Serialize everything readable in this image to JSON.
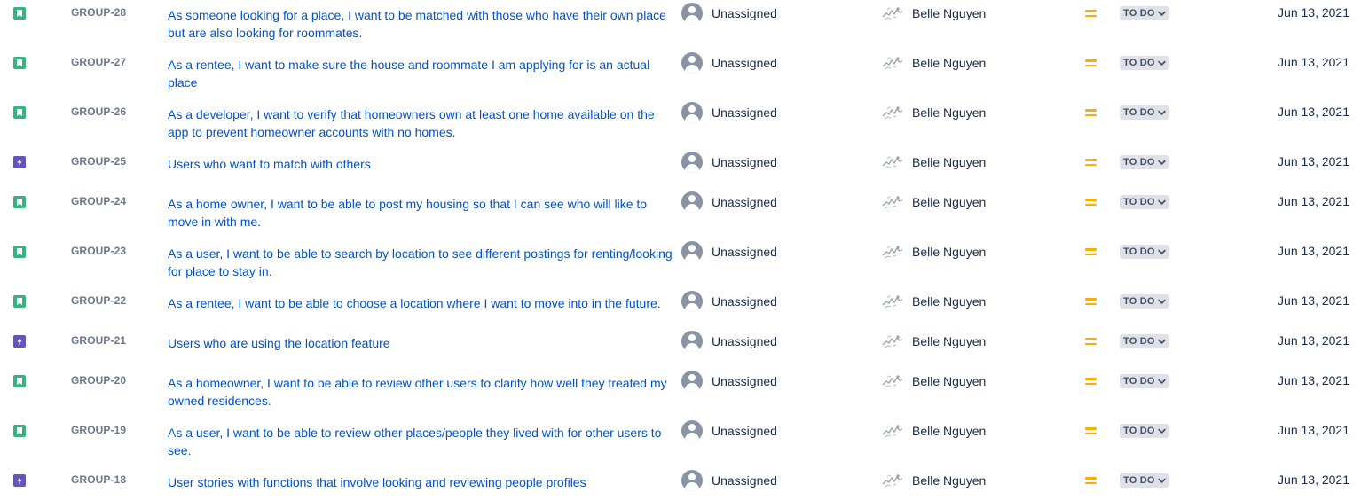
{
  "colors": {
    "story": "#36b37e",
    "epic": "#6554c0",
    "link": "#0052cc",
    "priority_medium": "#ffab00",
    "status_bg": "#dfe1e6"
  },
  "issues": [
    {
      "type": "story",
      "type_icon": "bookmark-icon",
      "key": "GROUP-28",
      "summary": "As someone looking for a place, I want to be matched with those who have their own place but are also looking for roommates.",
      "assignee": "Unassigned",
      "reporter": "Belle Nguyen",
      "priority": "medium-priority-icon",
      "status": "TO DO",
      "created": "Jun 13, 2021"
    },
    {
      "type": "story",
      "type_icon": "bookmark-icon",
      "key": "GROUP-27",
      "summary": "As a rentee, I want to make sure the house and roommate I am applying for is an actual place",
      "assignee": "Unassigned",
      "reporter": "Belle Nguyen",
      "priority": "medium-priority-icon",
      "status": "TO DO",
      "created": "Jun 13, 2021"
    },
    {
      "type": "story",
      "type_icon": "bookmark-icon",
      "key": "GROUP-26",
      "summary": "As a developer, I want to verify that homeowners own at least one home available on the app to prevent homeowner accounts with no homes.",
      "assignee": "Unassigned",
      "reporter": "Belle Nguyen",
      "priority": "medium-priority-icon",
      "status": "TO DO",
      "created": "Jun 13, 2021"
    },
    {
      "type": "epic",
      "type_icon": "lightning-icon",
      "key": "GROUP-25",
      "summary": "Users who want to match with others",
      "assignee": "Unassigned",
      "reporter": "Belle Nguyen",
      "priority": "medium-priority-icon",
      "status": "TO DO",
      "created": "Jun 13, 2021"
    },
    {
      "type": "story",
      "type_icon": "bookmark-icon",
      "key": "GROUP-24",
      "summary": "As a home owner, I want to be able to post my housing so that I can see who will like to move in with me.",
      "assignee": "Unassigned",
      "reporter": "Belle Nguyen",
      "priority": "medium-priority-icon",
      "status": "TO DO",
      "created": "Jun 13, 2021"
    },
    {
      "type": "story",
      "type_icon": "bookmark-icon",
      "key": "GROUP-23",
      "summary": "As a user, I want to be able to search by location to see different postings for renting/looking for place to stay in.",
      "assignee": "Unassigned",
      "reporter": "Belle Nguyen",
      "priority": "medium-priority-icon",
      "status": "TO DO",
      "created": "Jun 13, 2021"
    },
    {
      "type": "story",
      "type_icon": "bookmark-icon",
      "key": "GROUP-22",
      "summary": "As a rentee, I want to be able to choose a location where I want to move into in the future.",
      "assignee": "Unassigned",
      "reporter": "Belle Nguyen",
      "priority": "medium-priority-icon",
      "status": "TO DO",
      "created": "Jun 13, 2021"
    },
    {
      "type": "epic",
      "type_icon": "lightning-icon",
      "key": "GROUP-21",
      "summary": "Users who are using the location feature",
      "assignee": "Unassigned",
      "reporter": "Belle Nguyen",
      "priority": "medium-priority-icon",
      "status": "TO DO",
      "created": "Jun 13, 2021"
    },
    {
      "type": "story",
      "type_icon": "bookmark-icon",
      "key": "GROUP-20",
      "summary": "As a homeowner, I want to be able to review other users to clarify how well they treated my owned residences.",
      "assignee": "Unassigned",
      "reporter": "Belle Nguyen",
      "priority": "medium-priority-icon",
      "status": "TO DO",
      "created": "Jun 13, 2021"
    },
    {
      "type": "story",
      "type_icon": "bookmark-icon",
      "key": "GROUP-19",
      "summary": "As a user, I want to be able to review other places/people they lived with for other users to see.",
      "assignee": "Unassigned",
      "reporter": "Belle Nguyen",
      "priority": "medium-priority-icon",
      "status": "TO DO",
      "created": "Jun 13, 2021"
    },
    {
      "type": "epic",
      "type_icon": "lightning-icon",
      "key": "GROUP-18",
      "summary": "User stories with functions that involve looking and reviewing people profiles",
      "assignee": "Unassigned",
      "reporter": "Belle Nguyen",
      "priority": "medium-priority-icon",
      "status": "TO DO",
      "created": "Jun 13, 2021"
    }
  ]
}
